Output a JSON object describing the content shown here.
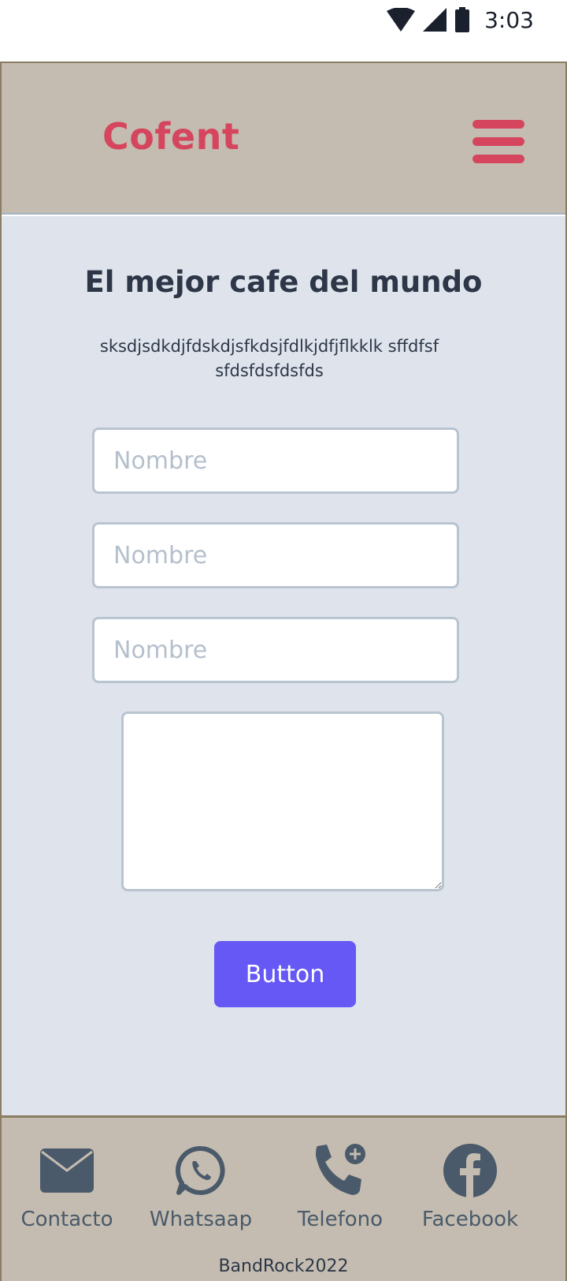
{
  "status_bar": {
    "time": "3:03",
    "icons": [
      "wifi-icon",
      "signal-icon",
      "battery-icon"
    ]
  },
  "header": {
    "brand": "Cofent",
    "menu_icon": "hamburger-menu-icon"
  },
  "main": {
    "title": "El mejor cafe del mundo",
    "description": "sksdjsdkdjfdskdjsfkdsjfdlkjdfjflkklk sffdfsfsfdsfdsfdsfds",
    "form": {
      "fields": [
        {
          "placeholder": "Nombre",
          "value": ""
        },
        {
          "placeholder": "Nombre",
          "value": ""
        },
        {
          "placeholder": "Nombre",
          "value": ""
        }
      ],
      "message_value": "",
      "submit_label": "Button"
    }
  },
  "footer": {
    "items": [
      {
        "label": "Contacto",
        "icon": "envelope-icon"
      },
      {
        "label": "Whatsaap",
        "icon": "whatsapp-icon"
      },
      {
        "label": "Telefono",
        "icon": "phone-add-icon"
      },
      {
        "label": "Facebook",
        "icon": "facebook-icon"
      }
    ],
    "copyright": "BandRock2022"
  },
  "colors": {
    "brand": "#d5465e",
    "header_bg": "#c4bcb0",
    "content_bg": "#dfe4ec",
    "button_bg": "#6558f5",
    "footer_icon": "#4a5a6a"
  }
}
